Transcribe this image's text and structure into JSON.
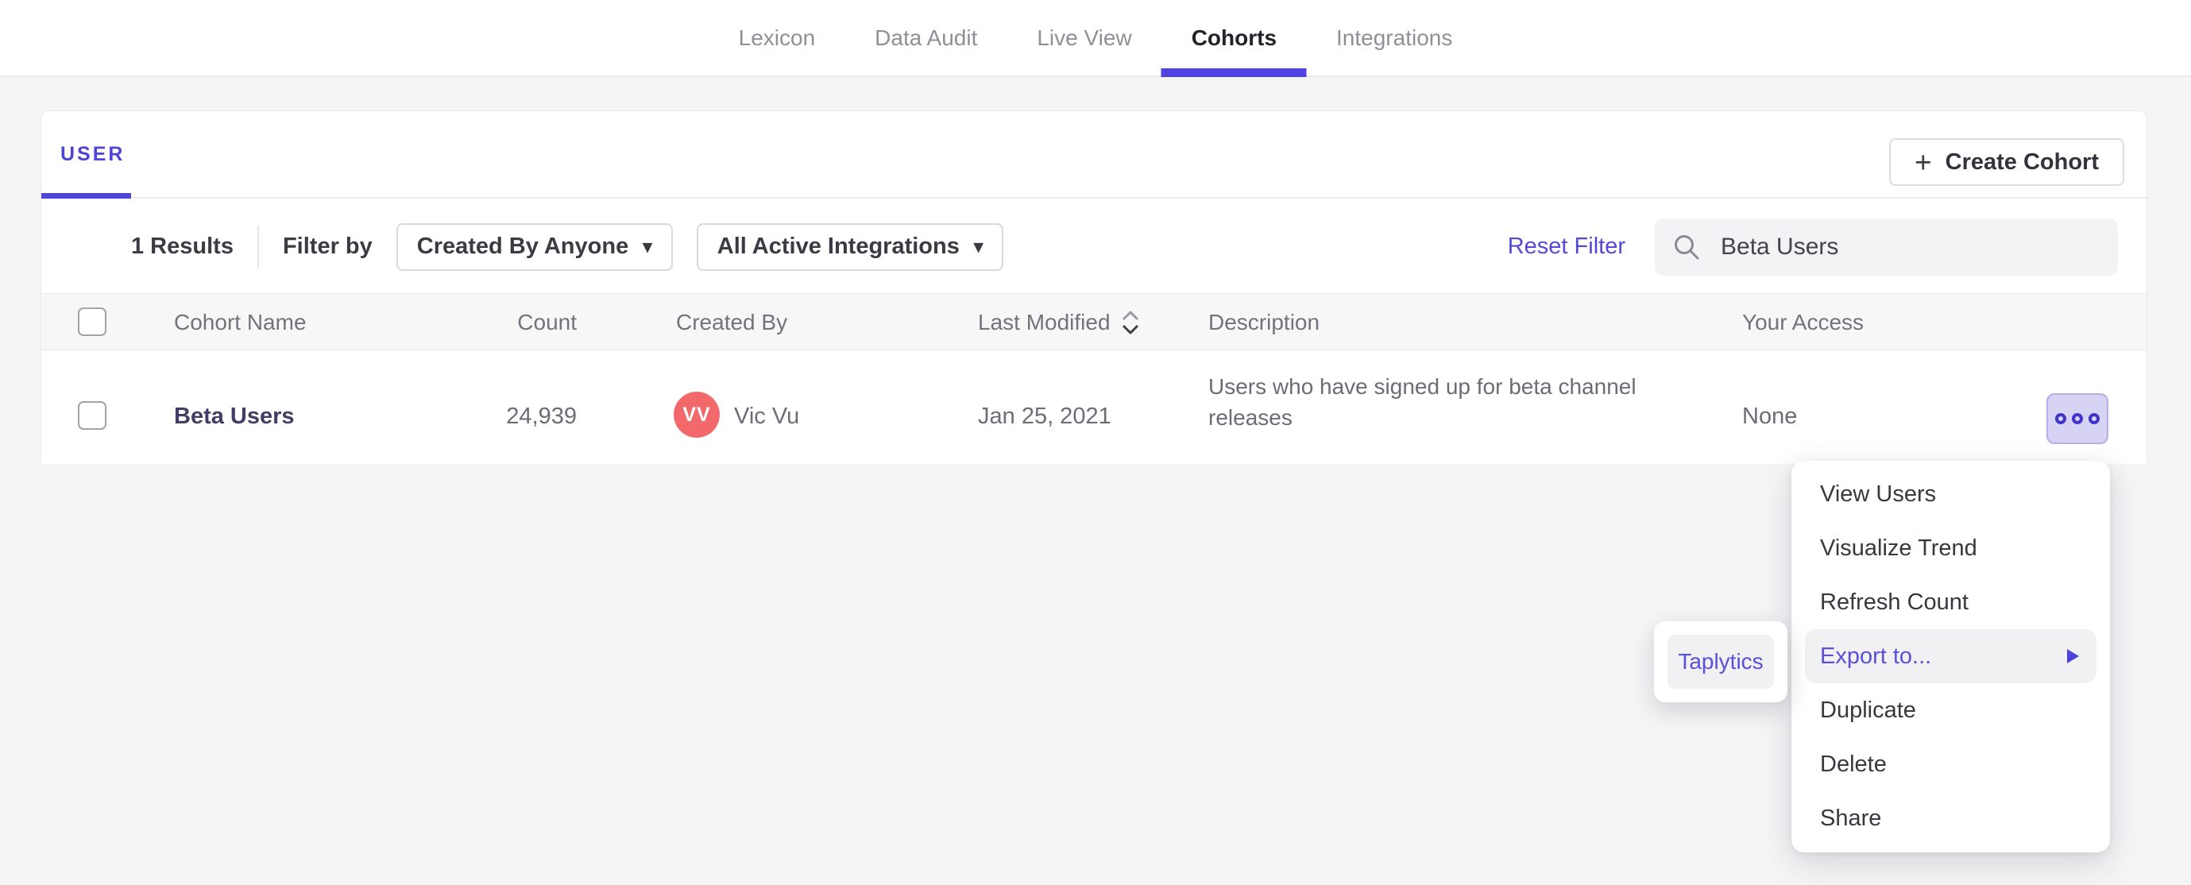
{
  "nav": {
    "active": "Cohorts",
    "items": [
      {
        "label": "Lexicon"
      },
      {
        "label": "Data Audit"
      },
      {
        "label": "Live View"
      },
      {
        "label": "Cohorts"
      },
      {
        "label": "Integrations"
      }
    ]
  },
  "cohorts_panel": {
    "tab_label": "USER",
    "create_button": {
      "plus_glyph": "+",
      "label": "Create Cohort"
    }
  },
  "filter_bar": {
    "results_text": "1 Results",
    "filter_by_label": "Filter by",
    "created_by_filter": {
      "value": "Created By Anyone"
    },
    "integrations_filter": {
      "value": "All Active Integrations"
    },
    "reset_filter_label": "Reset Filter",
    "search": {
      "value": "Beta Users"
    }
  },
  "icons": {
    "caret_down": "▾"
  },
  "table": {
    "headers": {
      "cohort_name": "Cohort Name",
      "count": "Count",
      "created_by": "Created By",
      "last_modified": "Last Modified",
      "description": "Description",
      "your_access": "Your Access"
    },
    "rows": [
      {
        "cohort_name": "Beta Users",
        "count": "24,939",
        "creator_initials": "VV",
        "creator_name": "Vic Vu",
        "last_modified": "Jan 25, 2021",
        "description": "Users who have signed up for beta channel releases",
        "your_access": "None"
      }
    ]
  },
  "context_menu": {
    "items": [
      {
        "label": "View Users"
      },
      {
        "label": "Visualize Trend"
      },
      {
        "label": "Refresh Count"
      },
      {
        "label": "Export to...",
        "highlighted": true,
        "has_submenu": true
      },
      {
        "label": "Duplicate"
      },
      {
        "label": "Delete"
      },
      {
        "label": "Share"
      }
    ]
  },
  "export_submenu": {
    "items": [
      {
        "label": "Taplytics"
      }
    ]
  },
  "colors": {
    "accent_purple": "#4f44d9",
    "nav_underline": "#4f43e2",
    "avatar_coral": "#f2696c",
    "menu_highlight": "#f1f1f4",
    "more_button_bg": "#d7d3f4",
    "page_background": "#f5f5f6"
  }
}
